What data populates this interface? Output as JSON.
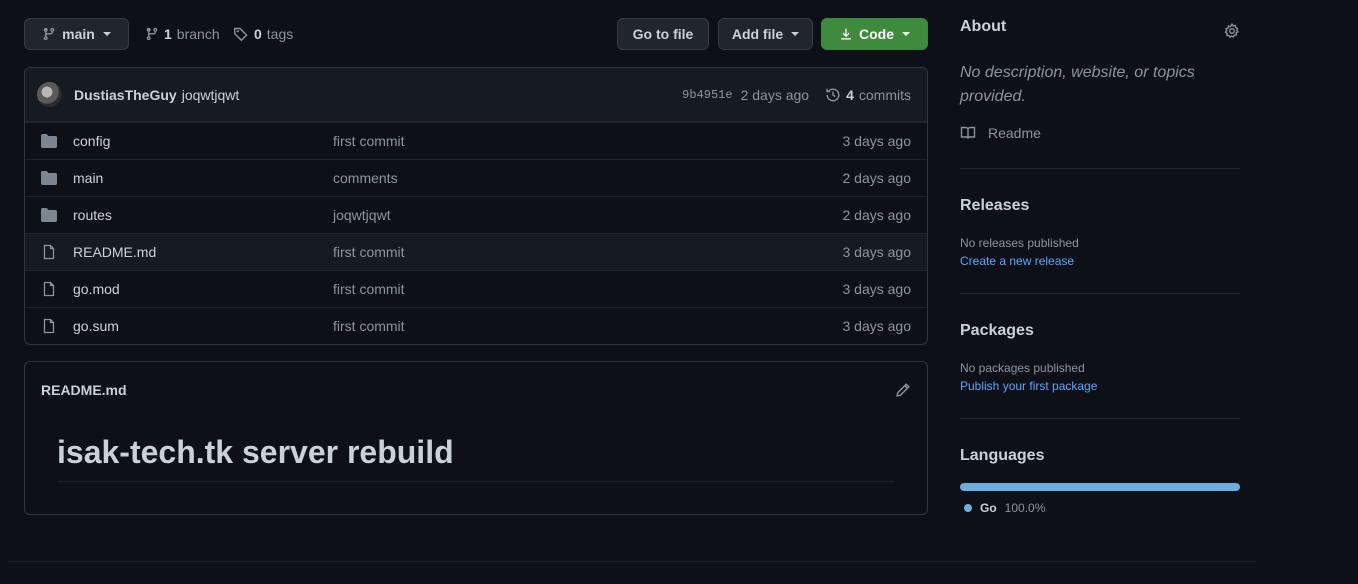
{
  "toolbar": {
    "branch_label": "main",
    "branch_count": "1",
    "branch_word": "branch",
    "tag_count": "0",
    "tag_word": "tags",
    "goto_label": "Go to file",
    "add_label": "Add file",
    "code_label": "Code"
  },
  "commit": {
    "author": "DustiasTheGuy",
    "message": "joqwtjqwt",
    "sha": "9b4951e",
    "time": "2 days ago",
    "count": "4",
    "count_word": "commits"
  },
  "files": [
    {
      "type": "folder",
      "name": "config",
      "message": "first commit",
      "age": "3 days ago"
    },
    {
      "type": "folder",
      "name": "main",
      "message": "comments",
      "age": "2 days ago"
    },
    {
      "type": "folder",
      "name": "routes",
      "message": "joqwtjqwt",
      "age": "2 days ago"
    },
    {
      "type": "file",
      "name": "README.md",
      "message": "first commit",
      "age": "3 days ago"
    },
    {
      "type": "file",
      "name": "go.mod",
      "message": "first commit",
      "age": "3 days ago"
    },
    {
      "type": "file",
      "name": "go.sum",
      "message": "first commit",
      "age": "3 days ago"
    }
  ],
  "readme": {
    "filename": "README.md",
    "heading": "isak-tech.tk server rebuild"
  },
  "sidebar": {
    "about_title": "About",
    "about_desc": "No description, website, or topics provided.",
    "readme_link": "Readme",
    "releases_title": "Releases",
    "releases_text": "No releases published",
    "releases_link": "Create a new release",
    "packages_title": "Packages",
    "packages_text": "No packages published",
    "packages_link": "Publish your first package",
    "languages_title": "Languages",
    "languages": [
      {
        "name": "Go",
        "percent": "100.0%",
        "share": 1.0,
        "color": "#68aee0"
      }
    ]
  },
  "colors": {
    "background": "#0d1117",
    "link": "#58a6ff",
    "code_button": "#3f8a3d"
  }
}
